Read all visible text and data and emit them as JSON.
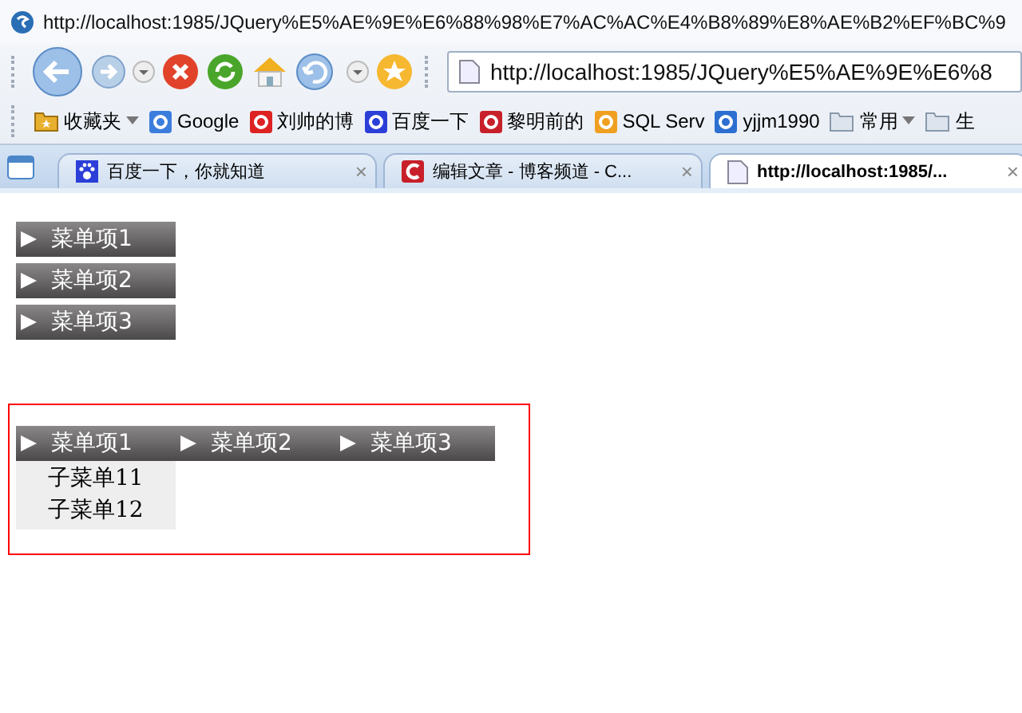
{
  "window": {
    "title": "http://localhost:1985/JQuery%E5%AE%9E%E6%88%98%E7%AC%AC%E4%B8%89%E8%AE%B2%EF%BC%9"
  },
  "address_bar": {
    "value": "http://localhost:1985/JQuery%E5%AE%9E%E6%8"
  },
  "bookmarks": [
    {
      "label": "收藏夹",
      "kind": "favorites"
    },
    {
      "label": "Google",
      "kind": "google"
    },
    {
      "label": "刘帅的博",
      "kind": "red"
    },
    {
      "label": "百度一下",
      "kind": "paw"
    },
    {
      "label": "黎明前的",
      "kind": "c"
    },
    {
      "label": "SQL Serv",
      "kind": "bulb"
    },
    {
      "label": "yjjm1990",
      "kind": "blue"
    },
    {
      "label": "常用",
      "kind": "folder"
    },
    {
      "label": "生",
      "kind": "folder"
    }
  ],
  "tabs": [
    {
      "label": "百度一下，你就知道",
      "close": "×",
      "kind": "paw",
      "selected": false
    },
    {
      "label": "编辑文章 - 博客频道 - C...",
      "close": "×",
      "kind": "c",
      "selected": false
    },
    {
      "label": "http://localhost:1985/...",
      "close": "×",
      "kind": "page",
      "selected": true
    }
  ],
  "vertical_menu": {
    "items": [
      {
        "label": "菜单项1"
      },
      {
        "label": "菜单项2"
      },
      {
        "label": "菜单项3"
      }
    ]
  },
  "horizontal_menu": {
    "items": [
      {
        "label": "菜单项1",
        "expanded": true,
        "children": [
          {
            "label": "子菜单11"
          },
          {
            "label": "子菜单12"
          }
        ]
      },
      {
        "label": "菜单项2"
      },
      {
        "label": "菜单项3"
      }
    ]
  }
}
